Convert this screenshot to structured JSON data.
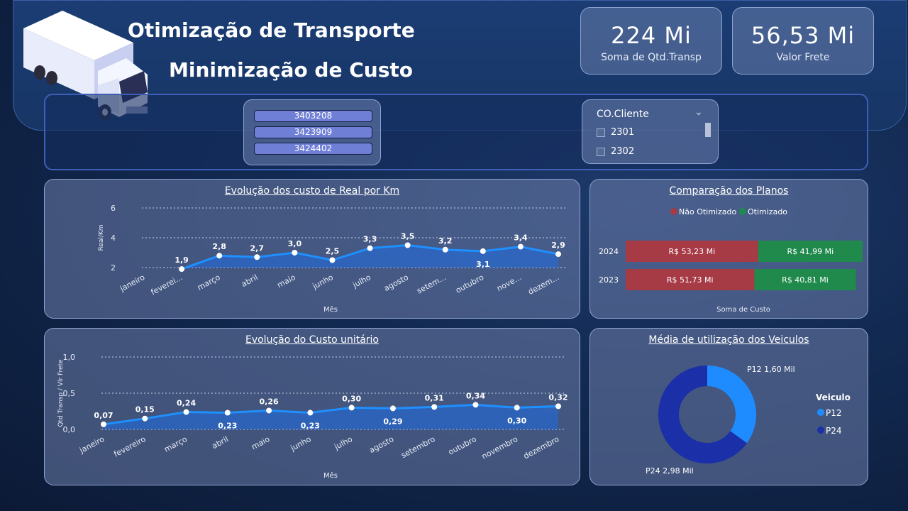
{
  "header": {
    "title_line1": "Otimização de Transporte",
    "title_line2": "Minimização de Custo"
  },
  "kpis": [
    {
      "value": "224 Mi",
      "label": "Soma de Qtd.Transp"
    },
    {
      "value": "56,53 Mi",
      "label": "Valor Frete"
    }
  ],
  "slicer_items": [
    "3403208",
    "3423909",
    "3424402"
  ],
  "cliente_filter": {
    "title": "CO.Cliente",
    "options": [
      "2301",
      "2302"
    ]
  },
  "chart_km": {
    "title": "Evolução dos custo de Real por Km",
    "xlabel": "Mês",
    "ylabel": "Real/Km",
    "ticks": [
      "2",
      "4",
      "6"
    ]
  },
  "chart_unit": {
    "title": "Evolução do Custo unitário",
    "xlabel": "Mês",
    "ylabel": "Qtd Transp / Vlr Frete",
    "ticks": [
      "0,0",
      "0,5",
      "1,0"
    ]
  },
  "chart_planos": {
    "title": "Comparação dos Planos",
    "legend": [
      "Não Otimizado",
      "Otimizado"
    ],
    "xlabel": "Soma de Custo"
  },
  "chart_veiculos": {
    "title": "Média de utilização dos Veiculos",
    "legend_title": "Veiculo",
    "legend": [
      "P12",
      "P24"
    ],
    "label_p12": "P12 1,60 Mil",
    "label_p24": "P24 2,98 Mil"
  },
  "colors": {
    "accent": "#1e90ff",
    "nao_otimizado": "#a63a45",
    "otimizado": "#1f8a4c",
    "p12": "#1e8cff",
    "p24": "#1a2fa8"
  },
  "chart_data": [
    {
      "type": "area",
      "title": "Evolução dos custo de Real por Km",
      "xlabel": "Mês",
      "ylabel": "Real/Km",
      "categories": [
        "janeiro",
        "fevereiro",
        "março",
        "abril",
        "maio",
        "junho",
        "julho",
        "agosto",
        "setembro",
        "outubro",
        "novembro",
        "dezembro"
      ],
      "category_labels": [
        "janeiro",
        "feverei...",
        "março",
        "abril",
        "maio",
        "junho",
        "julho",
        "agosto",
        "setem...",
        "outubro",
        "nove...",
        "dezem..."
      ],
      "values": [
        null,
        1.9,
        2.8,
        2.7,
        3.0,
        2.5,
        3.3,
        3.5,
        3.2,
        3.1,
        3.4,
        2.9
      ],
      "value_labels": [
        "",
        "1,9",
        "2,8",
        "2,7",
        "3,0",
        "2,5",
        "3,3",
        "3,5",
        "3,2",
        "3,1",
        "3,4",
        "2,9"
      ],
      "ylim": [
        2,
        6
      ],
      "grid": true
    },
    {
      "type": "area",
      "title": "Evolução do Custo unitário",
      "xlabel": "Mês",
      "ylabel": "Qtd Transp / Vlr Frete",
      "categories": [
        "janeiro",
        "fevereiro",
        "março",
        "abril",
        "maio",
        "junho",
        "julho",
        "agosto",
        "setembro",
        "outubro",
        "novembro",
        "dezembro"
      ],
      "category_labels": [
        "janeiro",
        "fevereiro",
        "março",
        "abril",
        "maio",
        "junho",
        "julho",
        "agosto",
        "setembro",
        "outubro",
        "novembro",
        "dezembro"
      ],
      "values": [
        0.07,
        0.15,
        0.24,
        0.23,
        0.26,
        0.23,
        0.3,
        0.29,
        0.31,
        0.34,
        0.3,
        0.32
      ],
      "value_labels": [
        "0,07",
        "0,15",
        "0,24",
        "0,23",
        "0,26",
        "0,23",
        "0,30",
        "0,29",
        "0,31",
        "0,34",
        "0,30",
        "0,32"
      ],
      "ylim": [
        0,
        1
      ],
      "grid": true
    },
    {
      "type": "bar",
      "orientation": "horizontal-stacked",
      "title": "Comparação dos Planos",
      "xlabel": "Soma de Custo",
      "categories": [
        "2024",
        "2023"
      ],
      "series": [
        {
          "name": "Não Otimizado",
          "values": [
            53.23,
            51.73
          ],
          "labels": [
            "R$ 53,23 Mi",
            "R$ 51,73 Mi"
          ]
        },
        {
          "name": "Otimizado",
          "values": [
            41.99,
            40.81
          ],
          "labels": [
            "R$ 41,99 Mi",
            "R$ 40,81 Mi"
          ]
        }
      ],
      "legend": "top"
    },
    {
      "type": "pie",
      "title": "Média de utilização dos Veiculos",
      "donut": true,
      "categories": [
        "P12",
        "P24"
      ],
      "values": [
        1.6,
        2.98
      ],
      "legend": "right"
    }
  ]
}
